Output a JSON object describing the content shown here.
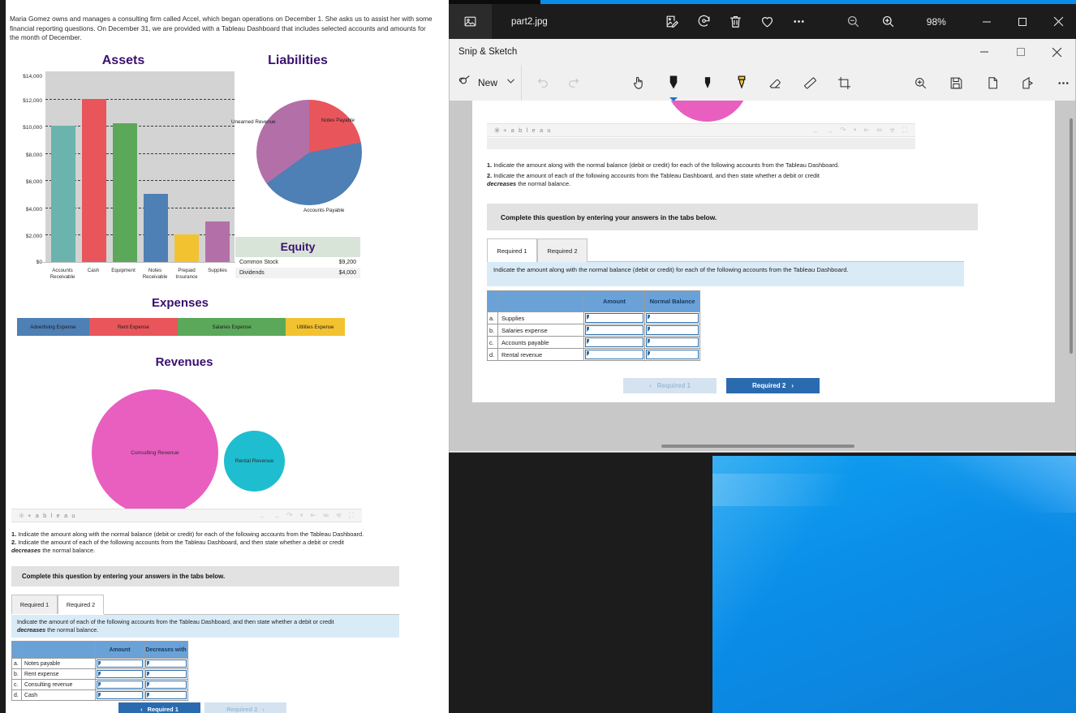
{
  "photos_window": {
    "app_icon": "picture-icon",
    "file_name": "part2.jpg",
    "tools": [
      {
        "name": "edit-image-icon",
        "label": "Edit image"
      },
      {
        "name": "rotate-icon",
        "label": "Rotate"
      },
      {
        "name": "delete-icon",
        "label": "Delete"
      },
      {
        "name": "favorite-heart-icon",
        "label": "Add to favorites"
      },
      {
        "name": "more-options-icon",
        "label": "See more"
      }
    ],
    "zoom_out_label": "Zoom out",
    "zoom_in_label": "Zoom in",
    "zoom_level": "98%",
    "minimize_label": "–",
    "maximize_label": "☐",
    "close_label": "✕"
  },
  "snip_window": {
    "title": "Snip & Sketch",
    "minimize_label": "─",
    "maximize_label": "☐",
    "close_label": "✕",
    "new_button_label": "New",
    "new_dropdown_label": "New snip options",
    "tools": [
      {
        "name": "undo-icon",
        "label": "Undo",
        "state": "disabled"
      },
      {
        "name": "redo-icon",
        "label": "Redo",
        "state": "disabled"
      },
      {
        "name": "touch-writing-icon",
        "label": "Touch writing",
        "state": "enabled"
      },
      {
        "name": "ballpoint-pen-icon",
        "label": "Ballpoint pen",
        "state": "selected"
      },
      {
        "name": "pencil-icon",
        "label": "Pencil",
        "state": "enabled"
      },
      {
        "name": "highlighter-icon",
        "label": "Highlighter",
        "state": "enabled"
      },
      {
        "name": "eraser-icon",
        "label": "Eraser",
        "state": "enabled"
      },
      {
        "name": "ruler-icon",
        "label": "Ruler",
        "state": "enabled"
      },
      {
        "name": "crop-icon",
        "label": "Crop",
        "state": "enabled"
      },
      {
        "name": "zoom-icon",
        "label": "Zoom",
        "state": "enabled"
      },
      {
        "name": "save-icon",
        "label": "Save as",
        "state": "enabled"
      },
      {
        "name": "copy-icon",
        "label": "Copy",
        "state": "enabled"
      },
      {
        "name": "share-icon",
        "label": "Share",
        "state": "enabled"
      },
      {
        "name": "more-icon",
        "label": "See more",
        "state": "enabled"
      }
    ]
  },
  "snip_content": {
    "tableau_logo": "+ a b l e a u",
    "tableau_icons": [
      "back-arrow-icon",
      "forward-arrow-icon",
      "revert-icon",
      "revert-dropdown-icon",
      "reset-icon",
      "share-icon",
      "download-icon",
      "fullscreen-icon"
    ],
    "question_1_num": "1.",
    "question_1": "Indicate the amount along with the normal balance (debit or credit) for each of the following accounts from the Tableau Dashboard.",
    "question_2_num": "2.",
    "question_2_a": "Indicate the amount of each of the following accounts from the Tableau Dashboard, and then state whether a debit or credit",
    "question_2_italic": "decreases",
    "question_2_b": "the normal balance.",
    "complete_banner": "Complete this question by entering your answers in the tabs below.",
    "tabs": [
      {
        "label": "Required 1",
        "active": true
      },
      {
        "label": "Required 2",
        "active": false
      }
    ],
    "instruction_line1": "Indicate the amount along with the normal balance (debit or credit) for each of the following accounts from the Tableau",
    "instruction_line2": "Dashboard.",
    "table": {
      "headers": [
        "",
        "",
        "Amount",
        "Normal Balance"
      ],
      "rows": [
        {
          "index": "a.",
          "account": "Supplies",
          "amount": "",
          "normal_balance": ""
        },
        {
          "index": "b.",
          "account": "Salaries expense",
          "amount": "",
          "normal_balance": ""
        },
        {
          "index": "c.",
          "account": "Accounts payable",
          "amount": "",
          "normal_balance": ""
        },
        {
          "index": "d.",
          "account": "Rental revenue",
          "amount": "",
          "normal_balance": ""
        }
      ]
    },
    "prev_button": "Required 1",
    "next_button": "Required 2",
    "prev_chevron": "‹",
    "next_chevron": "›",
    "prev_state": "disabled",
    "next_state": "active"
  },
  "left_panel": {
    "intro": "Maria Gomez owns and manages a consulting firm called Accel, which began operations on December 1. She asks us to assist her with some financial reporting questions. On December 31, we are provided with a Tableau Dashboard that includes selected accounts and amounts for the month of December.",
    "tableau_logo": "+ a b l e a u",
    "question_1_num": "1.",
    "question_1": "Indicate the amount along with the normal balance (debit or credit) for each of the following accounts from the Tableau Dashboard.",
    "question_2_num": "2.",
    "question_2_a": "Indicate the amount of each of the following accounts from the Tableau Dashboard, and then state whether a debit or credit",
    "question_2_italic": "decreases",
    "question_2_b": "the normal balance.",
    "complete_banner": "Complete this question by entering your answers in the tabs below.",
    "tabs": [
      {
        "label": "Required 1",
        "active": false
      },
      {
        "label": "Required 2",
        "active": true
      }
    ],
    "instruction_line1": "Indicate the amount of each of the following accounts from the Tableau Dashboard, and then state whether a debit or credit",
    "instruction_italic": "decreases",
    "instruction_line2": "the normal balance.",
    "table": {
      "headers": [
        "",
        "",
        "Amount",
        "Decreases with"
      ],
      "rows": [
        {
          "index": "a.",
          "account": "Notes payable",
          "amount": "",
          "decreases_with": ""
        },
        {
          "index": "b.",
          "account": "Rent expense",
          "amount": "",
          "decreases_with": ""
        },
        {
          "index": "c.",
          "account": "Consulting revenue",
          "amount": "",
          "decreases_with": ""
        },
        {
          "index": "d.",
          "account": "Cash",
          "amount": "",
          "decreases_with": ""
        }
      ]
    },
    "prev_button": "Required 1",
    "next_button": "Required 2",
    "prev_chevron": "‹",
    "next_chevron": "›",
    "prev_state": "active",
    "next_state": "disabled"
  },
  "equity": {
    "title": "Equity",
    "rows": [
      {
        "label": "Common Stock",
        "value": "$9,200"
      },
      {
        "label": "Dividends",
        "value": "$4,000"
      }
    ]
  },
  "chart_data": [
    {
      "type": "bar",
      "title": "Assets",
      "categories": [
        "Accounts Receivable",
        "Cash",
        "Equipment",
        "Notes Receivable",
        "Prepaid Insurance",
        "Supplies"
      ],
      "values": [
        10000,
        12000,
        10200,
        5000,
        2000,
        3000
      ],
      "colors": [
        "#6bb3ae",
        "#e8565b",
        "#5ba85a",
        "#4e7fb5",
        "#f2c230",
        "#b governance"
      ],
      "bar_colors": [
        "#6bb3ae",
        "#e8565b",
        "#5ba85a",
        "#4e7fb5",
        "#f2c230",
        "#b370a8"
      ],
      "ylim": [
        0,
        14000
      ],
      "yticks": [
        "$0",
        "$2,000",
        "$4,000",
        "$6,000",
        "$8,000",
        "$10,000",
        "$12,000",
        "$14,000"
      ],
      "xlabel": "",
      "ylabel": "",
      "grid": true
    },
    {
      "type": "pie",
      "title": "Liabilities",
      "labels": [
        "Notes Payable",
        "Accounts Payable",
        "Unearned Revenue"
      ],
      "values": [
        22,
        43,
        35
      ],
      "colors": [
        "#e8565b",
        "#4e7fb5",
        "#b370a8"
      ],
      "legend": "none"
    },
    {
      "type": "bar",
      "title": "Expenses",
      "orientation": "stacked-horizontal",
      "categories": [
        "Advertising Expense",
        "Rent Expense",
        "Salaries Expense",
        "Utilities Expense"
      ],
      "values": [
        22,
        27,
        33,
        18
      ],
      "colors": [
        "#4e7fb5",
        "#e8565b",
        "#5ba85a",
        "#f2c230"
      ],
      "legend": "inline"
    },
    {
      "type": "scatter",
      "subtype": "bubble",
      "title": "Revenues",
      "labels": [
        "Consulting Revenue",
        "Rental Revenue"
      ],
      "values": [
        100,
        33
      ],
      "colors": [
        "#e85fc0",
        "#1fbdd0"
      ],
      "legend": "inline"
    }
  ]
}
